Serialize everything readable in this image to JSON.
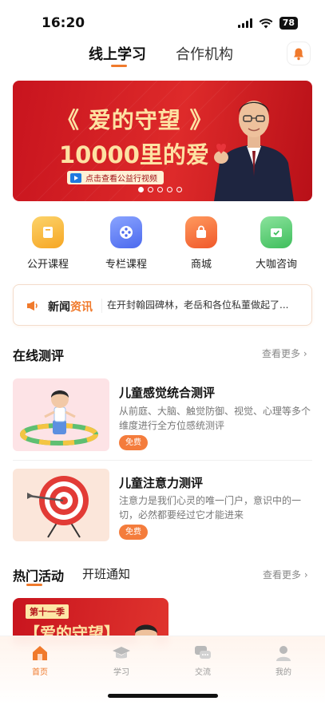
{
  "status": {
    "time": "16:20",
    "battery": "78"
  },
  "top_tabs": [
    {
      "label": "线上学习",
      "active": true
    },
    {
      "label": "合作机构",
      "active": false
    }
  ],
  "banner": {
    "title": "《 爱的守望 》",
    "subtitle": "10000里的爱",
    "cta": "点击查看公益行视频",
    "dots_total": 5,
    "active_dot": 0
  },
  "quick_entries": [
    {
      "label": "公开课程",
      "icon": "book-icon",
      "color": "#f8b531"
    },
    {
      "label": "专栏课程",
      "icon": "film-reel-icon",
      "color": "#5b7cf5"
    },
    {
      "label": "商城",
      "icon": "shopping-bag-icon",
      "color": "#f26b2f"
    },
    {
      "label": "大咖咨询",
      "icon": "mail-check-icon",
      "color": "#4cc46a"
    }
  ],
  "news": {
    "label_main": "新闻",
    "label_highlight": "资讯",
    "text": "在开封翰园碑林，老岳和各位私董做起了..."
  },
  "assessment": {
    "title": "在线测评",
    "more": "查看更多",
    "items": [
      {
        "title": "儿童感觉统合测评",
        "desc": "从前庭、大脑、触觉防御、视觉、心理等多个维度进行全方位感统测评",
        "badge": "免费"
      },
      {
        "title": "儿童注意力测评",
        "desc": "注意力是我们心灵的唯一门户，意识中的一切，必然都要经过它才能进来",
        "badge": "免费"
      }
    ]
  },
  "activities": {
    "tabs": [
      "热门活动",
      "开班通知"
    ],
    "more": "查看更多",
    "card_tag": "第十一季",
    "card_title": "【爱的守望】"
  },
  "bottom_nav": [
    {
      "label": "首页",
      "icon": "home-icon",
      "active": true
    },
    {
      "label": "学习",
      "icon": "graduation-cap-icon",
      "active": false
    },
    {
      "label": "交流",
      "icon": "chat-icon",
      "active": false
    },
    {
      "label": "我的",
      "icon": "user-icon",
      "active": false
    }
  ],
  "colors": {
    "accent": "#f07a2c",
    "banner_red": "#d81e24",
    "gold_text": "#fde2a3"
  }
}
